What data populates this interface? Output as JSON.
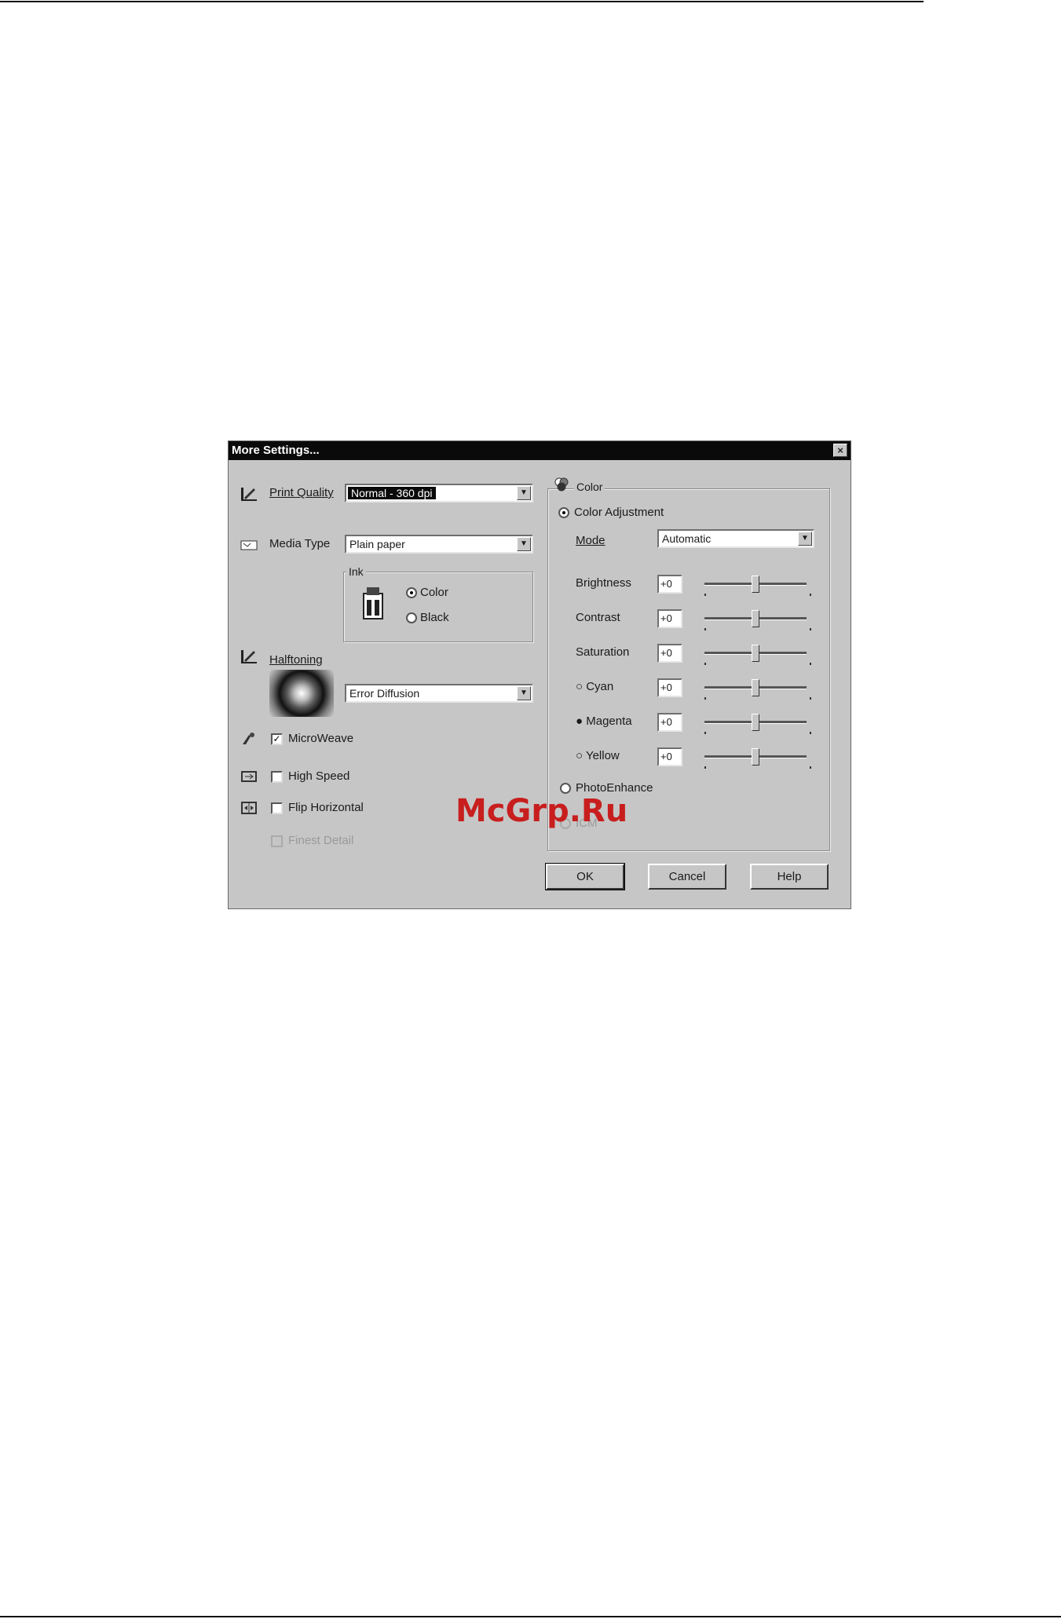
{
  "dialog": {
    "title": "More Settings...",
    "close_glyph": "×"
  },
  "print_quality": {
    "label": "Print Quality",
    "value": "Normal - 360 dpi",
    "icon": "print-quality-icon"
  },
  "media_type": {
    "label": "Media Type",
    "value": "Plain paper",
    "icon": "media-type-icon"
  },
  "ink": {
    "group_label": "Ink",
    "options": [
      {
        "label": "Color",
        "selected": true
      },
      {
        "label": "Black",
        "selected": false
      }
    ]
  },
  "halftoning": {
    "label": "Halftoning",
    "value": "Error Diffusion",
    "icon": "halftoning-icon"
  },
  "checkboxes": {
    "microweave": {
      "label": "MicroWeave",
      "checked": true
    },
    "high_speed": {
      "label": "High Speed",
      "checked": false
    },
    "flip_horizontal": {
      "label": "Flip Horizontal",
      "checked": false
    },
    "finest_detail": {
      "label": "Finest Detail",
      "checked": false,
      "disabled": true
    }
  },
  "color": {
    "group_label": "Color",
    "color_adjustment_label": "Color Adjustment",
    "color_adjustment_selected": true,
    "mode_label": "Mode",
    "mode_value": "Automatic",
    "sliders": [
      {
        "label": "Brightness",
        "value": "+0",
        "prefix": ""
      },
      {
        "label": "Contrast",
        "value": "+0",
        "prefix": ""
      },
      {
        "label": "Saturation",
        "value": "+0",
        "prefix": ""
      },
      {
        "label": "Cyan",
        "value": "+0",
        "prefix": "○"
      },
      {
        "label": "Magenta",
        "value": "+0",
        "prefix": "●"
      },
      {
        "label": "Yellow",
        "value": "+0",
        "prefix": "○"
      }
    ],
    "slider_level": 0.5,
    "photo_enhance_label": "PhotoEnhance",
    "icm_label": "ICM"
  },
  "buttons": {
    "ok": "OK",
    "cancel": "Cancel",
    "help": "Help"
  },
  "watermark": "McGrp.Ru",
  "colors": {
    "dialog_bg": "#c6c6c6",
    "titlebar": "#0a0a0a",
    "watermark": "#c81e1e"
  }
}
